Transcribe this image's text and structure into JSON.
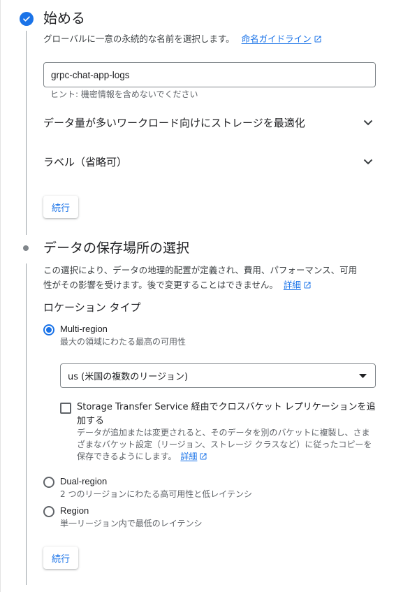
{
  "step1": {
    "title": "始める",
    "description": "グローバルに一意の永続的な名前を選択します。",
    "naming_link": "命名ガイドライン",
    "name_value": "grpc-chat-app-logs",
    "hint": "ヒント: 機密情報を含めないでください",
    "expander_optimize": "データ量が多いワークロード向けにストレージを最適化",
    "expander_labels": "ラベル（省略可）",
    "continue_label": "続行"
  },
  "step2": {
    "title": "データの保存場所の選択",
    "description_line1": "この選択により、データの地理的配置が定義され、費用、パフォーマンス、可用",
    "description_line2": "性がその影響を受けます。後で変更することはできません。",
    "details_link": "詳細",
    "location_type_heading": "ロケーション タイプ",
    "options": [
      {
        "label": "Multi-region",
        "sub": "最大の領域にわたる最高の可用性",
        "selected": true
      },
      {
        "label": "Dual-region",
        "sub": "2 つのリージョンにわたる高可用性と低レイテンシ",
        "selected": false
      },
      {
        "label": "Region",
        "sub": "単一リージョン内で最低のレイテンシ",
        "selected": false
      }
    ],
    "select_value": "us (米国の複数のリージョン)",
    "transfer_checkbox": {
      "label": "Storage Transfer Service 経由でクロスバケット レプリケーションを追加する",
      "description": "データが追加または変更されると、そのデータを別のバケットに複製し、さまざまなバケット設定（リージョン、ストレージ クラスなど）に従ったコピーを保存できるようにします。",
      "details_link": "詳細",
      "checked": false
    },
    "continue_label": "続行"
  },
  "colors": {
    "accent": "#1a73e8",
    "text": "#202124",
    "secondary_text": "#5f6368"
  }
}
